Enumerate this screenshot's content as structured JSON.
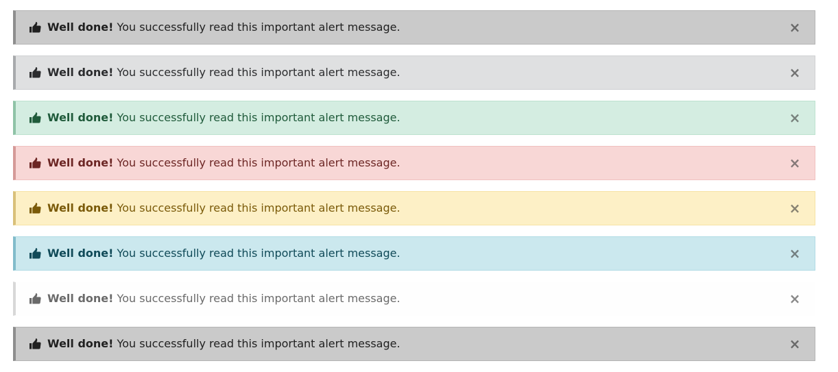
{
  "alerts": [
    {
      "variant": "dark",
      "icon": "thumbs-up-icon",
      "strong": "Well done!",
      "text": " You successfully read this important alert message.",
      "close": "×"
    },
    {
      "variant": "light",
      "icon": "thumbs-up-icon",
      "strong": "Well done!",
      "text": " You successfully read this important alert message.",
      "close": "×"
    },
    {
      "variant": "success",
      "icon": "thumbs-up-icon",
      "strong": "Well done!",
      "text": " You successfully read this important alert message.",
      "close": "×"
    },
    {
      "variant": "danger",
      "icon": "thumbs-up-icon",
      "strong": "Well done!",
      "text": " You successfully read this important alert message.",
      "close": "×"
    },
    {
      "variant": "warning",
      "icon": "thumbs-up-icon",
      "strong": "Well done!",
      "text": " You successfully read this important alert message.",
      "close": "×"
    },
    {
      "variant": "info",
      "icon": "thumbs-up-icon",
      "strong": "Well done!",
      "text": " You successfully read this important alert message.",
      "close": "×"
    },
    {
      "variant": "white",
      "icon": "thumbs-up-icon",
      "strong": "Well done!",
      "text": " You successfully read this important alert message.",
      "close": "×"
    },
    {
      "variant": "dark",
      "icon": "thumbs-up-icon",
      "strong": "Well done!",
      "text": " You successfully read this important alert message.",
      "close": "×"
    }
  ],
  "colors": {
    "dark": "#cacaca",
    "light": "#dfe0e1",
    "success": "#d4ede1",
    "danger": "#f8d7d6",
    "warning": "#fdf0c6",
    "info": "#cbe8ee",
    "white": "#fefefe"
  }
}
